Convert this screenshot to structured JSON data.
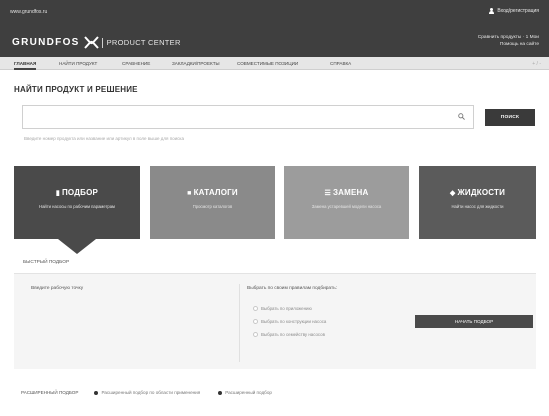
{
  "header": {
    "site_link": "www.grundfos.ru",
    "user_link": "Вход/регистрация",
    "brand_name": "GRUNDFOS",
    "brand_sub": "PRODUCT CENTER",
    "links": [
      "Сравнить продукты · 1 Мои",
      "Помощь на сайте"
    ]
  },
  "nav": {
    "items": [
      {
        "label": "ГЛАВНАЯ",
        "active": true
      },
      {
        "label": "НАЙТИ ПРОДУКТ",
        "active": false
      },
      {
        "label": "СРАВНЕНИЕ",
        "active": false
      },
      {
        "label": "ЗАКЛАДКИ/ПРОЕКТЫ",
        "active": false
      },
      {
        "label": "СОВМЕСТИМЫЕ ПОЗИЦИИ",
        "active": false
      },
      {
        "label": "СПРАВКА",
        "active": false
      }
    ],
    "right": "+ / -"
  },
  "search": {
    "title": "НАЙТИ ПРОДУКТ И РЕШЕНИЕ",
    "placeholder": "",
    "button_label": "ПОИСК",
    "hint": "Введите номер продукта или название или артикул в поле выше для поиска"
  },
  "tiles": [
    {
      "icon": "▮",
      "title": "ПОДБОР",
      "subtitle": "Найти насосы по рабочим параметрам",
      "color": "#4a4a4a"
    },
    {
      "icon": "■",
      "title": "КАТАЛОГИ",
      "subtitle": "Просмотр каталогов",
      "color": "#8a8a8a"
    },
    {
      "icon": "☰",
      "title": "ЗАМЕНА",
      "subtitle": "Замена устаревшей модели насоса",
      "color": "#9c9c9c"
    },
    {
      "icon": "◆",
      "title": "ЖИДКОСТИ",
      "subtitle": "Найти насос для жидкости",
      "color": "#5b5b5b"
    }
  ],
  "quick": {
    "title": "БЫСТРЫЙ ПОДБОР",
    "duty_label": "Введите рабочую точку",
    "choose_label": "Выбрать по своим правилам подбирать:",
    "options": [
      "Выбрать по приложению",
      "Выбрать по конструкции насоса",
      "Выбрать по семейству насосов"
    ],
    "button_label": "НАЧАТЬ ПОДБОР"
  },
  "advanced": {
    "title": "РАСШИРЕННЫЙ ПОДБОР",
    "options": [
      "Расширенный подбор по области применения",
      "Расширенный подбор"
    ]
  },
  "colors": {
    "header_bg": "#3f3f3f",
    "nav_bg": "#e6e6e6",
    "accent": "#3a3a3a"
  }
}
